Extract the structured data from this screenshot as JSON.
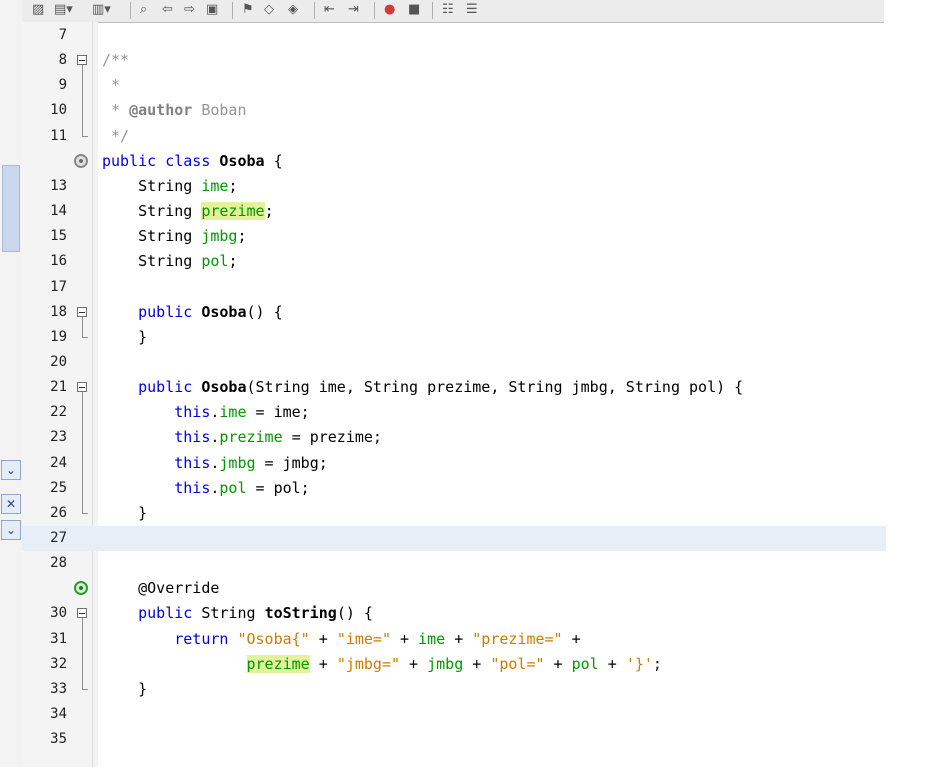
{
  "toolbar": {
    "icons": [
      "open-project-icon",
      "new-file-icon",
      "back-icon",
      "find-icon",
      "find-previous-icon",
      "find-next-icon",
      "toggle-highlight-icon",
      "previous-bookmark-icon",
      "next-bookmark-icon",
      "toggle-bookmark-icon",
      "shift-left-icon",
      "shift-right-icon",
      "start-macro-icon",
      "stop-macro-icon",
      "comment-icon",
      "uncomment-icon"
    ]
  },
  "editor": {
    "current_line": "27",
    "lines": [
      {
        "n": "7",
        "c": []
      },
      {
        "n": "8",
        "c": [
          {
            "t": "/**",
            "k": "cm"
          }
        ]
      },
      {
        "n": "9",
        "c": [
          {
            "t": " *",
            "k": "cm"
          }
        ]
      },
      {
        "n": "10",
        "c": [
          {
            "t": " * ",
            "k": "cm"
          },
          {
            "t": "@author",
            "k": "cmb"
          },
          {
            "t": " Boban",
            "k": "cm"
          }
        ]
      },
      {
        "n": "11",
        "c": [
          {
            "t": " */",
            "k": "cm"
          }
        ]
      },
      {
        "n": "",
        "c": [
          {
            "t": "public class ",
            "k": "kw"
          },
          {
            "t": "Osoba",
            "k": "bold"
          },
          {
            "t": " {",
            "k": ""
          }
        ]
      },
      {
        "n": "13",
        "c": [
          {
            "t": "    String ",
            "k": ""
          },
          {
            "t": "ime",
            "k": "fld"
          },
          {
            "t": ";",
            "k": ""
          }
        ]
      },
      {
        "n": "14",
        "c": [
          {
            "t": "    String ",
            "k": ""
          },
          {
            "t": "prezime",
            "k": "fld hl"
          },
          {
            "t": ";",
            "k": ""
          }
        ]
      },
      {
        "n": "15",
        "c": [
          {
            "t": "    String ",
            "k": ""
          },
          {
            "t": "jmbg",
            "k": "fld"
          },
          {
            "t": ";",
            "k": ""
          }
        ]
      },
      {
        "n": "16",
        "c": [
          {
            "t": "    String ",
            "k": ""
          },
          {
            "t": "pol",
            "k": "fld"
          },
          {
            "t": ";",
            "k": ""
          }
        ]
      },
      {
        "n": "17",
        "c": []
      },
      {
        "n": "18",
        "c": [
          {
            "t": "    ",
            "k": ""
          },
          {
            "t": "public ",
            "k": "kw"
          },
          {
            "t": "Osoba",
            "k": "bold"
          },
          {
            "t": "() {",
            "k": ""
          }
        ]
      },
      {
        "n": "19",
        "c": [
          {
            "t": "    }",
            "k": ""
          }
        ]
      },
      {
        "n": "20",
        "c": []
      },
      {
        "n": "21",
        "c": [
          {
            "t": "    ",
            "k": ""
          },
          {
            "t": "public ",
            "k": "kw"
          },
          {
            "t": "Osoba",
            "k": "bold"
          },
          {
            "t": "(String ime, String prezime, String jmbg, String pol) {",
            "k": ""
          }
        ]
      },
      {
        "n": "22",
        "c": [
          {
            "t": "        ",
            "k": ""
          },
          {
            "t": "this",
            "k": "kw"
          },
          {
            "t": ".",
            "k": ""
          },
          {
            "t": "ime",
            "k": "fld"
          },
          {
            "t": " = ime;",
            "k": ""
          }
        ]
      },
      {
        "n": "23",
        "c": [
          {
            "t": "        ",
            "k": ""
          },
          {
            "t": "this",
            "k": "kw"
          },
          {
            "t": ".",
            "k": ""
          },
          {
            "t": "prezime",
            "k": "fld"
          },
          {
            "t": " = prezime;",
            "k": ""
          }
        ]
      },
      {
        "n": "24",
        "c": [
          {
            "t": "        ",
            "k": ""
          },
          {
            "t": "this",
            "k": "kw"
          },
          {
            "t": ".",
            "k": ""
          },
          {
            "t": "jmbg",
            "k": "fld"
          },
          {
            "t": " = jmbg;",
            "k": ""
          }
        ]
      },
      {
        "n": "25",
        "c": [
          {
            "t": "        ",
            "k": ""
          },
          {
            "t": "this",
            "k": "kw"
          },
          {
            "t": ".",
            "k": ""
          },
          {
            "t": "pol",
            "k": "fld"
          },
          {
            "t": " = pol;",
            "k": ""
          }
        ]
      },
      {
        "n": "26",
        "c": [
          {
            "t": "    }",
            "k": ""
          }
        ]
      },
      {
        "n": "27",
        "c": []
      },
      {
        "n": "28",
        "c": []
      },
      {
        "n": "",
        "c": [
          {
            "t": "    @Override",
            "k": ""
          }
        ]
      },
      {
        "n": "30",
        "c": [
          {
            "t": "    ",
            "k": ""
          },
          {
            "t": "public ",
            "k": "kw"
          },
          {
            "t": "String ",
            "k": ""
          },
          {
            "t": "toString",
            "k": "bold"
          },
          {
            "t": "() {",
            "k": ""
          }
        ]
      },
      {
        "n": "31",
        "c": [
          {
            "t": "        ",
            "k": ""
          },
          {
            "t": "return ",
            "k": "kw"
          },
          {
            "t": "\"Osoba{\"",
            "k": "str"
          },
          {
            "t": " + ",
            "k": ""
          },
          {
            "t": "\"ime=\"",
            "k": "str"
          },
          {
            "t": " + ",
            "k": ""
          },
          {
            "t": "ime",
            "k": "fld"
          },
          {
            "t": " + ",
            "k": ""
          },
          {
            "t": "\"prezime=\"",
            "k": "str"
          },
          {
            "t": " +",
            "k": ""
          }
        ]
      },
      {
        "n": "32",
        "c": [
          {
            "t": "                ",
            "k": ""
          },
          {
            "t": "prezime",
            "k": "fld hl"
          },
          {
            "t": " + ",
            "k": ""
          },
          {
            "t": "\"jmbg=\"",
            "k": "str"
          },
          {
            "t": " + ",
            "k": ""
          },
          {
            "t": "jmbg",
            "k": "fld"
          },
          {
            "t": " + ",
            "k": ""
          },
          {
            "t": "\"pol=\"",
            "k": "str"
          },
          {
            "t": " + ",
            "k": ""
          },
          {
            "t": "pol",
            "k": "fld"
          },
          {
            "t": " + ",
            "k": ""
          },
          {
            "t": "'}'",
            "k": "str"
          },
          {
            "t": ";",
            "k": ""
          }
        ]
      },
      {
        "n": "33",
        "c": [
          {
            "t": "    }",
            "k": ""
          }
        ]
      },
      {
        "n": "34",
        "c": []
      },
      {
        "n": "35",
        "c": []
      }
    ]
  }
}
